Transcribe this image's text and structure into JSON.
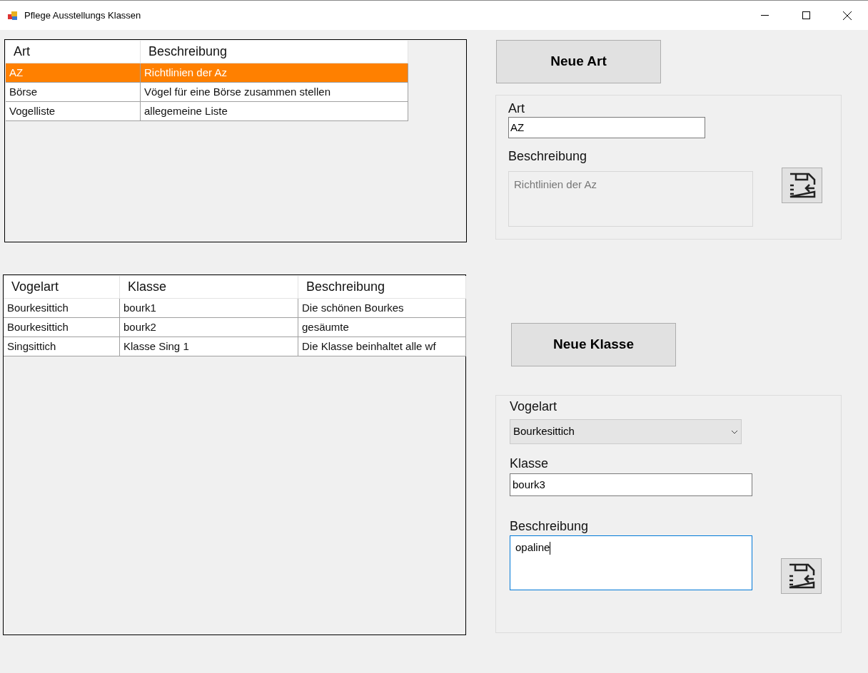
{
  "window": {
    "title": "Pflege Ausstellungs Klassen"
  },
  "art_table": {
    "columns": [
      "Art",
      "Beschreibung"
    ],
    "rows": [
      {
        "cells": [
          "AZ",
          "Richtlinien der Az"
        ],
        "selected": true
      },
      {
        "cells": [
          "Börse",
          "Vögel für eine Börse zusammen stellen"
        ],
        "selected": false
      },
      {
        "cells": [
          "Vogelliste",
          "allegemeine Liste"
        ],
        "selected": false
      }
    ]
  },
  "klasse_table": {
    "columns": [
      "Vogelart",
      "Klasse",
      "Beschreibung"
    ],
    "rows": [
      {
        "cells": [
          "Bourkesittich",
          "bourk1",
          "Die schönen Bourkes"
        ],
        "selected": false
      },
      {
        "cells": [
          "Bourkesittich",
          "bourk2",
          "gesäumte"
        ],
        "selected": false
      },
      {
        "cells": [
          "Singsittich",
          "Klasse Sing 1",
          "Die Klasse beinhaltet alle wf"
        ],
        "selected": false
      }
    ]
  },
  "neue_art_button": "Neue Art",
  "art_form": {
    "art": {
      "label": "Art",
      "value": "AZ"
    },
    "beschreibung": {
      "label": "Beschreibung",
      "value": "Richtlinien der Az",
      "disabled": true,
      "focused": false
    }
  },
  "neue_klasse_button": "Neue Klasse",
  "klasse_form": {
    "vogelart": {
      "label": "Vogelart",
      "value": "Bourkesittich"
    },
    "klasse": {
      "label": "Klasse",
      "value": "bourk3"
    },
    "beschreibung": {
      "label": "Beschreibung",
      "value": "opaline",
      "disabled": false,
      "focused": true
    }
  }
}
